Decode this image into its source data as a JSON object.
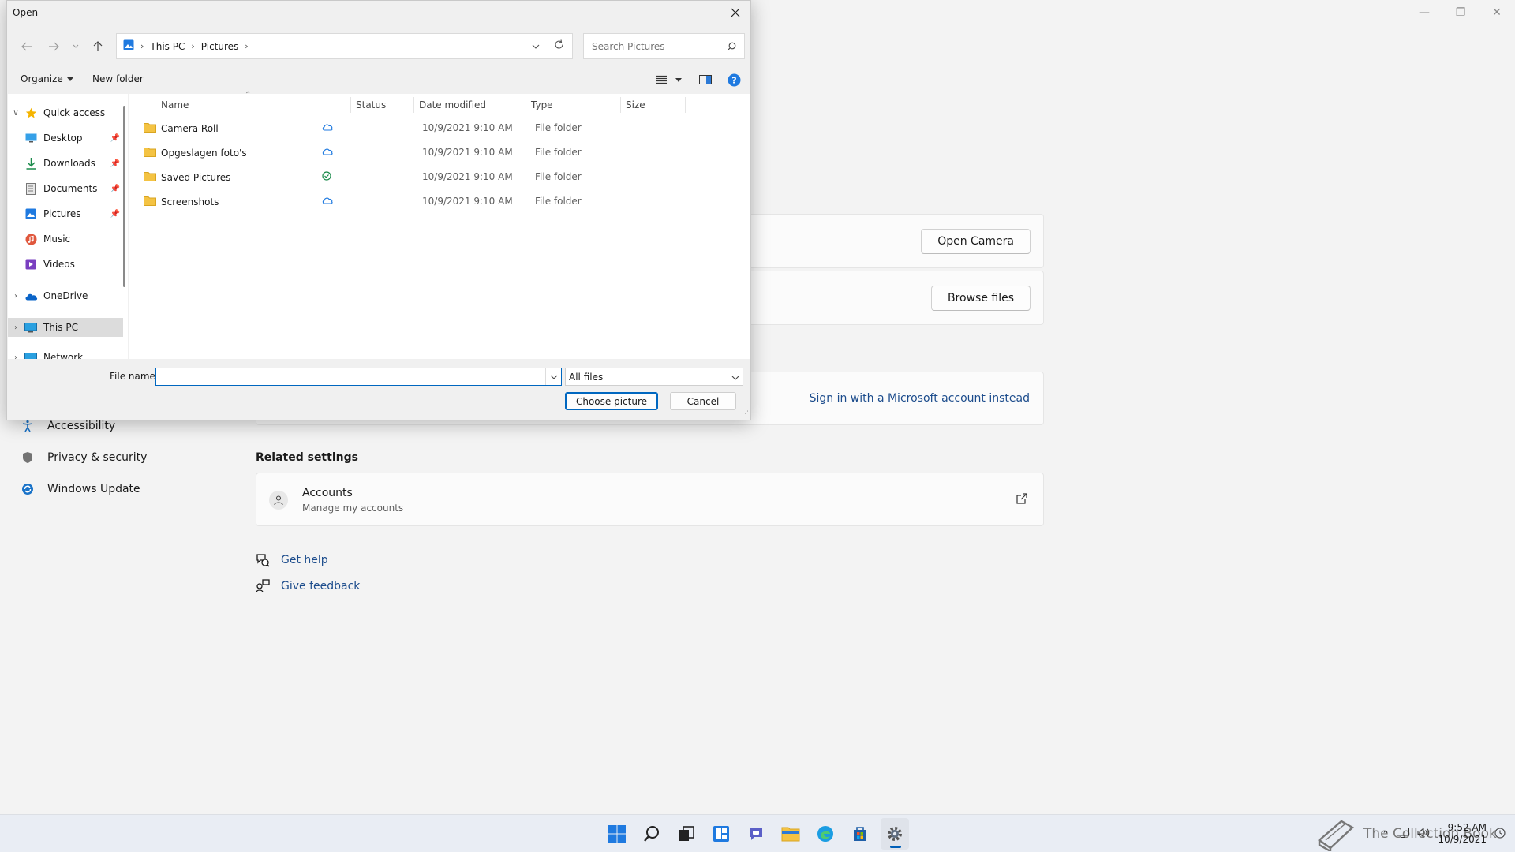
{
  "settings": {
    "nav": [
      {
        "label": "Accessibility"
      },
      {
        "label": "Privacy & security"
      },
      {
        "label": "Windows Update"
      }
    ],
    "cards": {
      "camera_button": "Open Camera",
      "browse_button": "Browse files",
      "signin_link": "Sign in with a Microsoft account instead"
    },
    "related_title": "Related settings",
    "accounts": {
      "title": "Accounts",
      "subtitle": "Manage my accounts"
    },
    "help": {
      "get_help": "Get help",
      "feedback": "Give feedback"
    }
  },
  "dialog": {
    "title": "Open",
    "breadcrumb": [
      "This PC",
      "Pictures"
    ],
    "search_placeholder": "Search Pictures",
    "toolbar": {
      "organize": "Organize",
      "new_folder": "New folder"
    },
    "nav_items": [
      {
        "label": "Quick access",
        "icon": "star-icon",
        "expand": "open",
        "indent": 0,
        "pinned": false
      },
      {
        "label": "Desktop",
        "icon": "desktop-icon",
        "indent": 1,
        "pinned": true
      },
      {
        "label": "Downloads",
        "icon": "download-icon",
        "indent": 1,
        "pinned": true
      },
      {
        "label": "Documents",
        "icon": "document-icon",
        "indent": 1,
        "pinned": true
      },
      {
        "label": "Pictures",
        "icon": "pictures-icon",
        "indent": 1,
        "pinned": true
      },
      {
        "label": "Music",
        "icon": "music-icon",
        "indent": 1,
        "pinned": false
      },
      {
        "label": "Videos",
        "icon": "videos-icon",
        "indent": 1,
        "pinned": false
      },
      {
        "label": "OneDrive",
        "icon": "onedrive-icon",
        "expand": "closed",
        "indent": 0,
        "pinned": false
      },
      {
        "label": "This PC",
        "icon": "this-pc-icon",
        "expand": "closed",
        "indent": 0,
        "pinned": false,
        "selected": true
      },
      {
        "label": "Network",
        "icon": "network-icon",
        "expand": "closed",
        "indent": 0,
        "pinned": false
      }
    ],
    "columns": [
      "Name",
      "Status",
      "Date modified",
      "Type",
      "Size"
    ],
    "files": [
      {
        "name": "Camera Roll",
        "status": "cloud",
        "date": "10/9/2021 9:10 AM",
        "type": "File folder"
      },
      {
        "name": "Opgeslagen foto's",
        "status": "cloud",
        "date": "10/9/2021 9:10 AM",
        "type": "File folder"
      },
      {
        "name": "Saved Pictures",
        "status": "synced",
        "date": "10/9/2021 9:10 AM",
        "type": "File folder"
      },
      {
        "name": "Screenshots",
        "status": "cloud",
        "date": "10/9/2021 9:10 AM",
        "type": "File folder"
      }
    ],
    "file_name_label": "File name:",
    "file_name_value": "",
    "file_type": "All files",
    "choose_button": "Choose picture",
    "cancel_button": "Cancel"
  },
  "taskbar": {
    "apps": [
      "start-icon",
      "search-icon",
      "task-view-icon",
      "widgets-icon",
      "chat-icon",
      "file-explorer-icon",
      "edge-icon",
      "store-icon",
      "settings-icon"
    ],
    "active_app": "settings-icon",
    "time": "9:52 AM",
    "date": "10/9/2021",
    "watermark": "The Collection Book"
  },
  "colors": {
    "accent": "#0067c0",
    "link": "#1c4c8c",
    "folder": "#f4c343"
  }
}
